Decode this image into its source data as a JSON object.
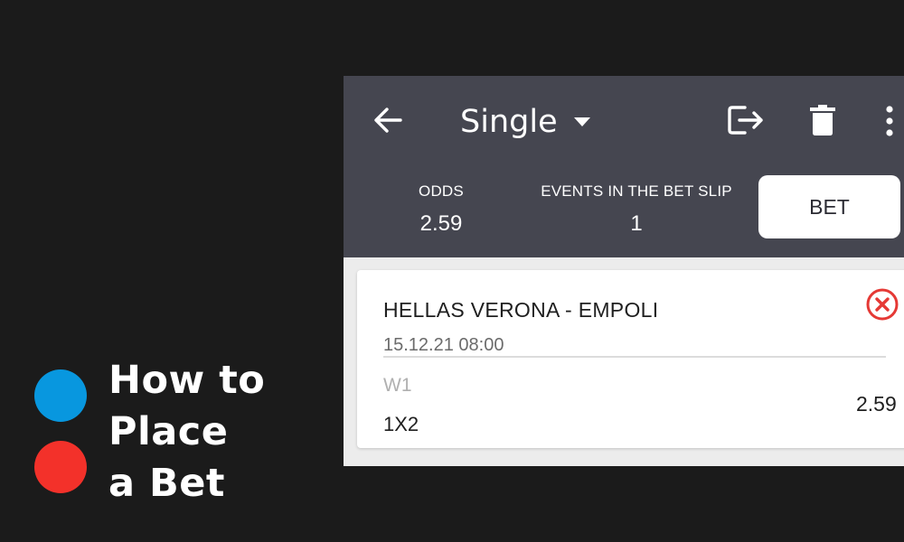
{
  "promo": {
    "lines": [
      "How to",
      "Place",
      "a Bet"
    ],
    "dot_colors": [
      "#0897df",
      "#f3312a"
    ]
  },
  "header": {
    "back_icon": "arrow-left-icon",
    "mode": "Single",
    "share_icon": "logout-share-icon",
    "delete_icon": "trash-icon",
    "menu_icon": "more-vertical-icon"
  },
  "summary": {
    "odds_label": "ODDS",
    "odds_value": "2.59",
    "events_label": "EVENTS IN THE BET SLIP",
    "events_value": "1",
    "bet_label": "BET"
  },
  "bet_card": {
    "match": "HELLAS VERONA - EMPOLI",
    "datetime": "15.12.21 08:00",
    "outcome": "W1",
    "market": "1X2",
    "coefficient": "2.59",
    "remove_icon": "close-circle-icon"
  },
  "colors": {
    "background": "#1b1b1b",
    "header": "#454650",
    "remove_accent": "#e53935"
  }
}
